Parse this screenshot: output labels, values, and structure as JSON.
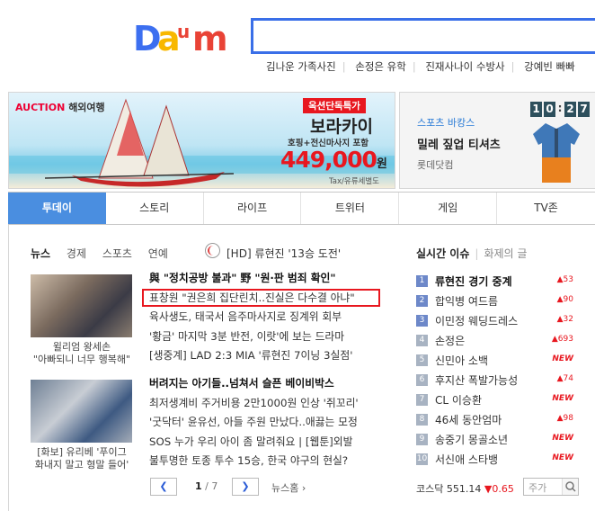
{
  "brand": {
    "logo_text": "Daum",
    "logo_colors": [
      "#3c6ff0",
      "#f8b800",
      "#e94336",
      "#8e44ad"
    ]
  },
  "search": {
    "placeholder": ""
  },
  "issue_keywords": [
    "김나운 가족사진",
    "손정은 유학",
    "진재사나이 수방사",
    "강예빈 빠빠"
  ],
  "ad_left": {
    "auction": "AUCTION",
    "category": "해외여행",
    "badge": "옥션단독특가",
    "destination": "보라카이",
    "desc": "호핑+전신마사지 포함",
    "price": "449,000",
    "unit": "원",
    "note": "Tax/유류세별도"
  },
  "ad_right": {
    "tag": "스포츠 바캉스",
    "title": "밀레 짚업 티셔츠",
    "seller": "롯데닷컴",
    "clock": [
      "1",
      "0",
      "2",
      "7"
    ]
  },
  "tabs": [
    "투데이",
    "스토리",
    "라이프",
    "트위터",
    "게임",
    "TV존"
  ],
  "news_subtabs": [
    "뉴스",
    "경제",
    "스포츠",
    "연예"
  ],
  "hd_headline": "[HD] 류현진 '13승 도전'",
  "thumb_captions": {
    "first": [
      "윌리엄 왕세손",
      "\"아빠되니 너무 행복해\""
    ],
    "second": [
      "[화보] 유리베 '푸이그",
      "화내지 말고 형말 들어'"
    ]
  },
  "news_a": [
    "與 \"정치공방 불과\" 野 \"원·판 범죄 확인\"",
    "표창원 \"권은희 집단린치..진실은 다수결 아냐\"",
    "육사생도, 태국서 음주마사지로 징계위 회부",
    "'황금' 마지막 3분 반전, 이랏'에 보는 드라마",
    "[생중계] LAD 2:3 MIA '류현진 7이닝 3실점'"
  ],
  "news_b": [
    "버려지는 아기들..넘쳐서 슬픈 베이비박스",
    "최저생계비 주거비용 2만1000원 인상 '쥐꼬리'",
    "'굿닥터' 윤유선, 아들 주원 만났다..애끓는 모정",
    "SOS 누가 우리 아이 좀 말려줘요 | [웹툰]외발",
    "불투명한 토종 투수 15승, 한국 야구의 현실?"
  ],
  "pager": {
    "current": "1",
    "total": "/ 7",
    "home": "뉴스홈"
  },
  "trending": {
    "tab_on": "실시간 이슈",
    "tab_off": "화제의 글",
    "items": [
      {
        "rank": "1",
        "keyword": "류현진 경기 중계",
        "change": "▲53"
      },
      {
        "rank": "2",
        "keyword": "합익병 여드름",
        "change": "▲90"
      },
      {
        "rank": "3",
        "keyword": "이민정 웨딩드레스",
        "change": "▲32"
      },
      {
        "rank": "4",
        "keyword": "손정은",
        "change": "▲693"
      },
      {
        "rank": "5",
        "keyword": "신민아 소백",
        "change": "NEW"
      },
      {
        "rank": "6",
        "keyword": "후지산 폭발가능성",
        "change": "▲74"
      },
      {
        "rank": "7",
        "keyword": "CL 이승환",
        "change": "NEW"
      },
      {
        "rank": "8",
        "keyword": "46세 동안엄마",
        "change": "▲98"
      },
      {
        "rank": "9",
        "keyword": "송중기 몽골소년",
        "change": "NEW"
      },
      {
        "rank": "10",
        "keyword": "서신애 스타뱅",
        "change": "NEW"
      }
    ]
  },
  "kospi": {
    "label": "코스닥",
    "value": "551.14",
    "change": "▼0.65"
  },
  "quote_input": {
    "placeholder": "주가"
  }
}
